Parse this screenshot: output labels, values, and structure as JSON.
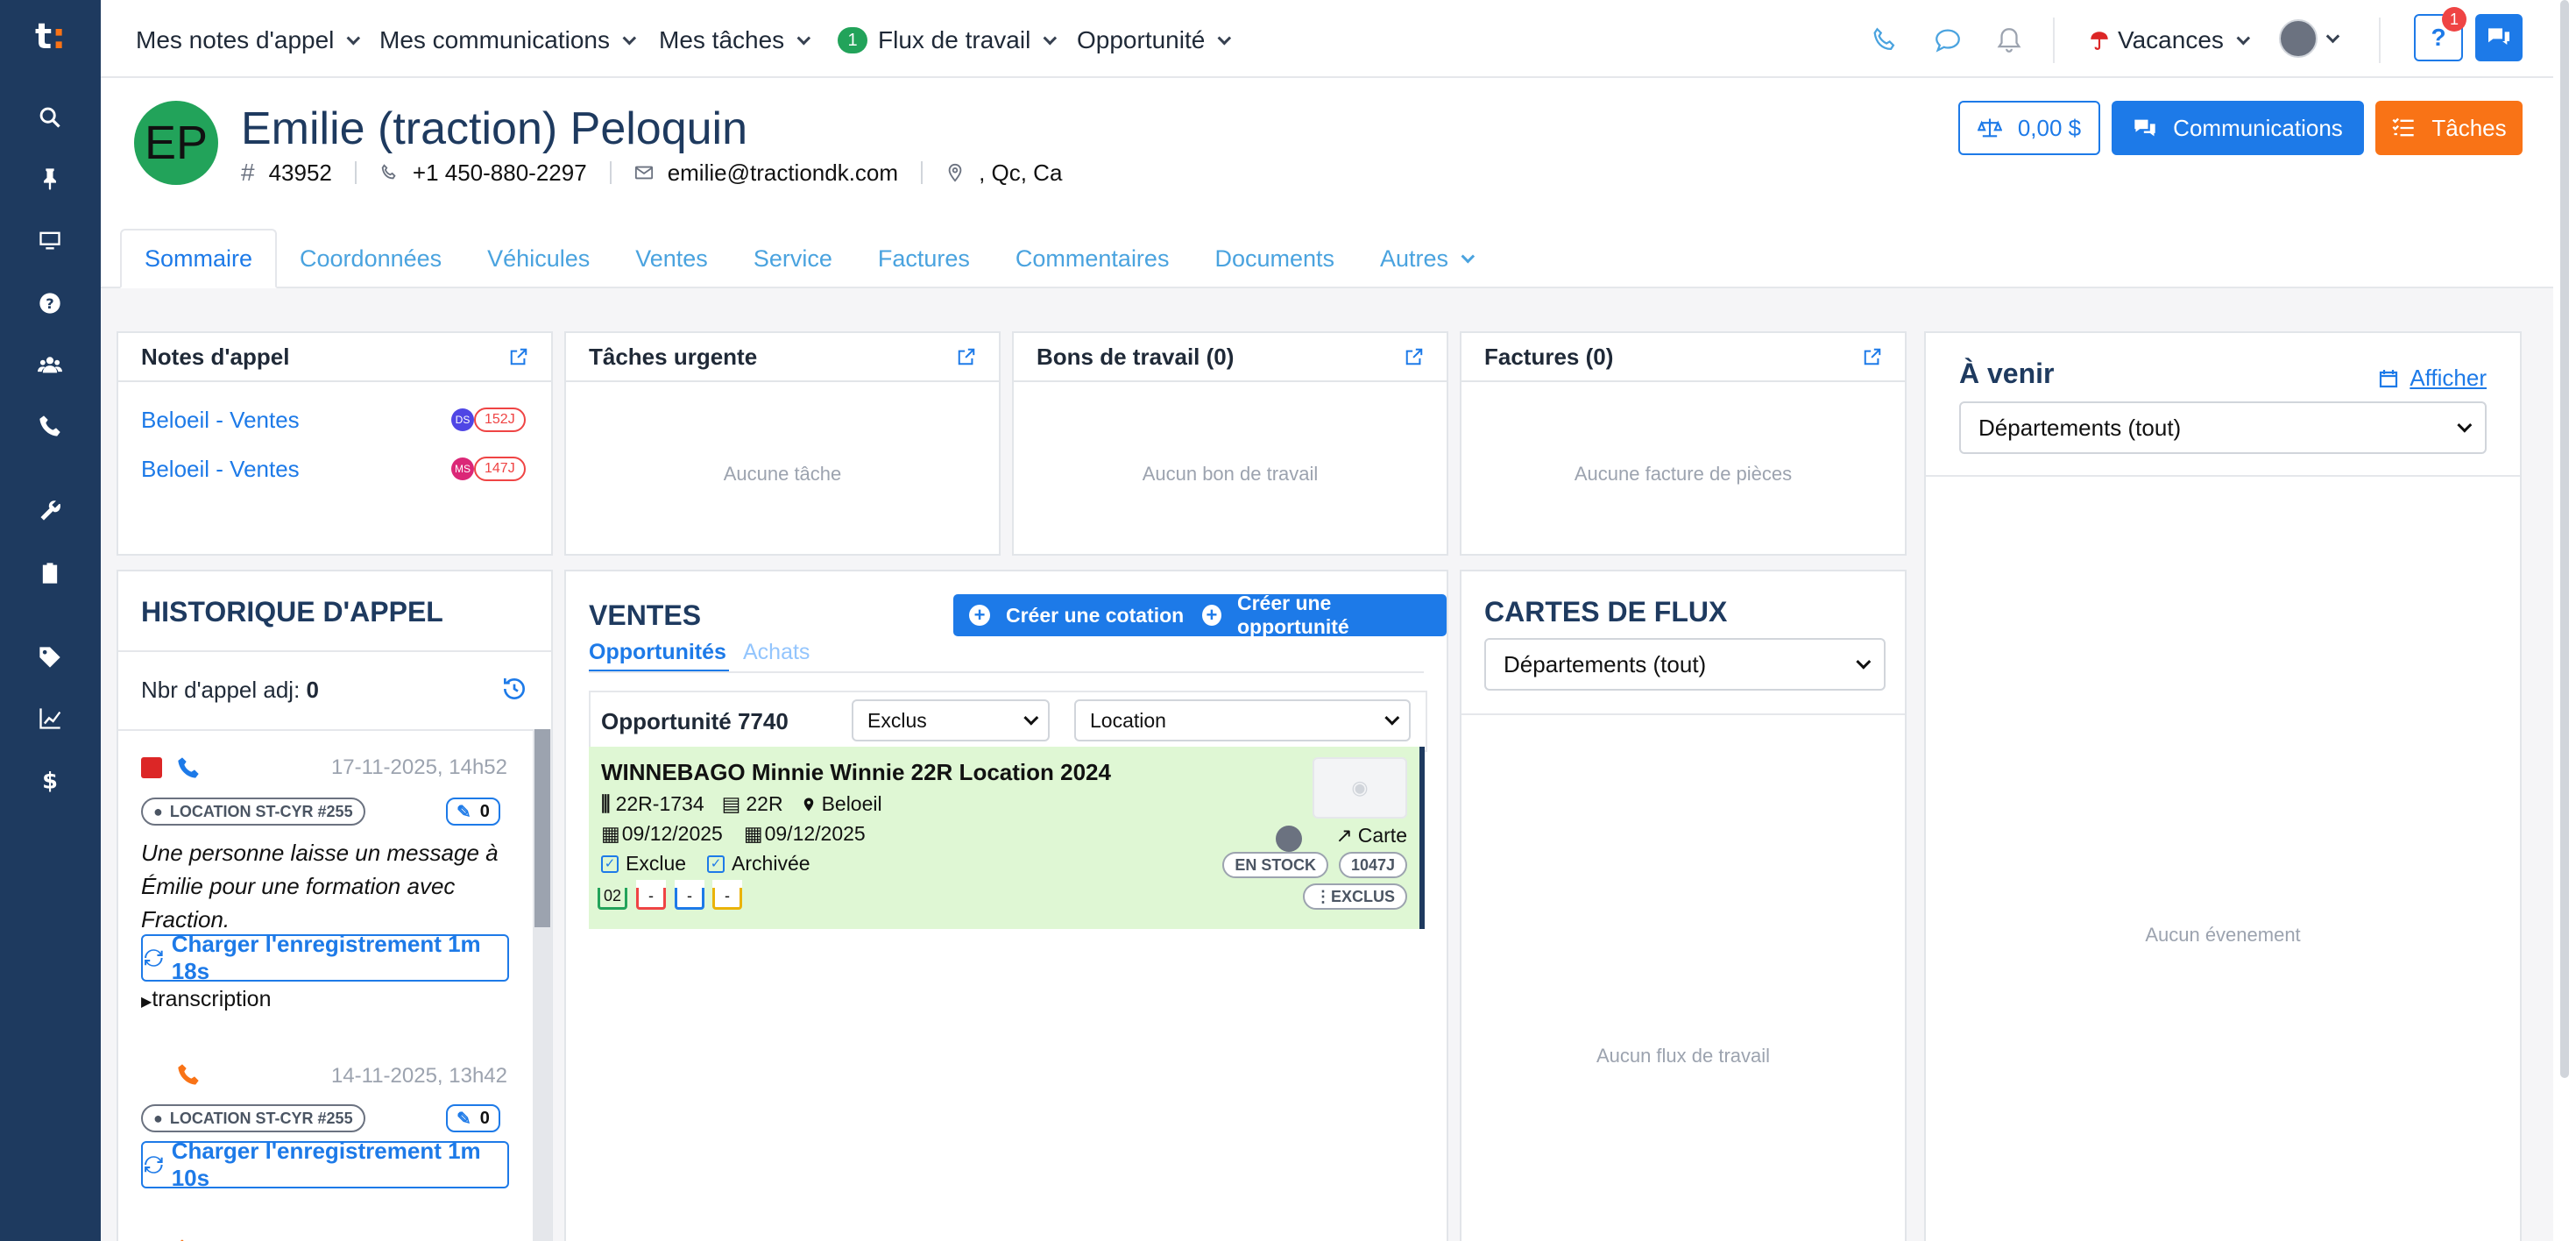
{
  "nav": {
    "items": [
      {
        "label": "Mes notes d'appel"
      },
      {
        "label": "Mes communications"
      },
      {
        "label": "Mes tâches"
      },
      {
        "label": "Flux de travail",
        "badge": "1"
      },
      {
        "label": "Opportunité"
      }
    ],
    "vacation_label": "Vacances",
    "help_badge": "1"
  },
  "contact": {
    "initials": "EP",
    "name": "Emilie (traction) Peloquin",
    "id": "43952",
    "phone": "+1 450-880-2297",
    "email": "emilie@tractiondk.com",
    "location": ", Qc, Ca"
  },
  "actions": {
    "balance": "0,00 $",
    "communications": "Communications",
    "taches": "Tâches"
  },
  "tabs": [
    "Sommaire",
    "Coordonnées",
    "Véhicules",
    "Ventes",
    "Service",
    "Factures",
    "Commentaires",
    "Documents",
    "Autres"
  ],
  "notes": {
    "title": "Notes d'appel",
    "items": [
      {
        "label": "Beloeil - Ventes",
        "initials": "DS",
        "days": "152J",
        "color": "#4f46e5"
      },
      {
        "label": "Beloeil - Ventes",
        "initials": "MS",
        "days": "147J",
        "color": "#db2777"
      }
    ]
  },
  "urgent": {
    "title": "Tâches urgente",
    "empty": "Aucune tâche"
  },
  "bons": {
    "title": "Bons de travail (0)",
    "empty": "Aucun bon de travail"
  },
  "factures": {
    "title": "Factures (0)",
    "empty": "Aucune facture de pièces"
  },
  "avenir": {
    "title": "À venir",
    "show": "Afficher",
    "dept": "Départements (tout)",
    "empty": "Aucun évenement"
  },
  "historique": {
    "title": "HISTORIQUE D'APPEL",
    "count_label": "Nbr d'appel adj:",
    "count": "0",
    "calls": [
      {
        "date": "17-11-2025, 14h52",
        "location": "LOCATION ST-CYR #255",
        "count": "0",
        "text": "Une personne laisse un message à Émilie pour une formation avec Fraction.",
        "record": "Charger l'enregistrement 1m 18s",
        "transcription": "transcription"
      },
      {
        "date": "14-11-2025, 13h42",
        "location": "LOCATION ST-CYR #255",
        "count": "0",
        "record": "Charger l'enregistrement 1m 10s"
      }
    ]
  },
  "ventes": {
    "title": "VENTES",
    "btn_cotation": "Créer une cotation",
    "btn_opportunite": "Créer une opportunité",
    "tab_opps": "Opportunités",
    "tab_achats": "Achats",
    "opp_title": "Opportunité 7740",
    "filter_status": "Exclus",
    "filter_type": "Location",
    "unit": {
      "name": "WINNEBAGO Minnie Winnie 22R Location 2024",
      "stock": "22R-1734",
      "model": "22R",
      "branch": "Beloeil",
      "date1": "09/12/2025",
      "date2": "09/12/2025",
      "carte": "Carte",
      "exclue": "Exclue",
      "archivee": "Archivée",
      "status": "EN STOCK",
      "age": "1047J",
      "exclus_tag": "EXCLUS",
      "cal_values": [
        "02",
        "-",
        "-",
        "-"
      ],
      "cal_colors": [
        "#22a35a",
        "#ef4444",
        "#1d7ae8",
        "#eab308"
      ]
    }
  },
  "flux": {
    "title": "CARTES DE FLUX",
    "dept": "Départements (tout)",
    "empty": "Aucun flux de travail"
  }
}
